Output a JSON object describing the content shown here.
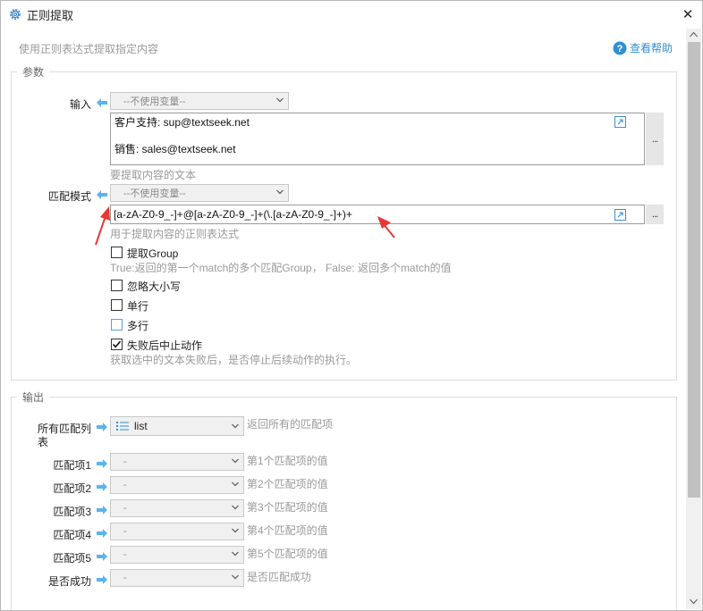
{
  "window": {
    "title": "正则提取",
    "close_glyph": "✕"
  },
  "description": "使用正则表达式提取指定内容",
  "help_link": "查看帮助",
  "params": {
    "group_label": "参数",
    "input": {
      "label": "输入",
      "variable_select": "--不使用变量--",
      "text_line1": "客户支持: sup@textseek.net",
      "text_line2": "销售: sales@textseek.net",
      "hint": "要提取内容的文本"
    },
    "pattern": {
      "label": "匹配模式",
      "variable_select": "--不使用变量--",
      "value": "[a-zA-Z0-9_-]+@[a-zA-Z0-9_-]+(\\.[a-zA-Z0-9_-]+)+",
      "hint": "用于提取内容的正则表达式"
    },
    "options": {
      "extract_group": {
        "label": "提取Group",
        "checked": false,
        "hint": "True:返回的第一个match的多个匹配Group， False: 返回多个match的值"
      },
      "ignore_case": {
        "label": "忽略大小写",
        "checked": false
      },
      "single_line": {
        "label": "单行",
        "checked": false
      },
      "multi_line": {
        "label": "多行",
        "checked": false
      },
      "stop_on_fail": {
        "label": "失败后中止动作",
        "checked": true,
        "hint": "获取选中的文本失败后，是否停止后续动作的执行。"
      }
    },
    "more_button": "..."
  },
  "output": {
    "group_label": "输出",
    "rows": [
      {
        "label_line1": "所有匹配列",
        "label_line2": "表",
        "value": "list",
        "hint": "返回所有的匹配项"
      },
      {
        "label": "匹配项1",
        "value": "-",
        "hint": "第1个匹配项的值"
      },
      {
        "label": "匹配项2",
        "value": "-",
        "hint": "第2个匹配项的值"
      },
      {
        "label": "匹配项3",
        "value": "-",
        "hint": "第3个匹配项的值"
      },
      {
        "label": "匹配项4",
        "value": "-",
        "hint": "第4个匹配项的值"
      },
      {
        "label": "匹配项5",
        "value": "-",
        "hint": "第5个匹配项的值"
      },
      {
        "label": "是否成功",
        "value": "-",
        "hint": "是否匹配成功"
      }
    ]
  },
  "colors": {
    "accent": "#2f8fd6",
    "arrow_blue": "#5ab4f0",
    "annotation_red": "#e53935"
  }
}
